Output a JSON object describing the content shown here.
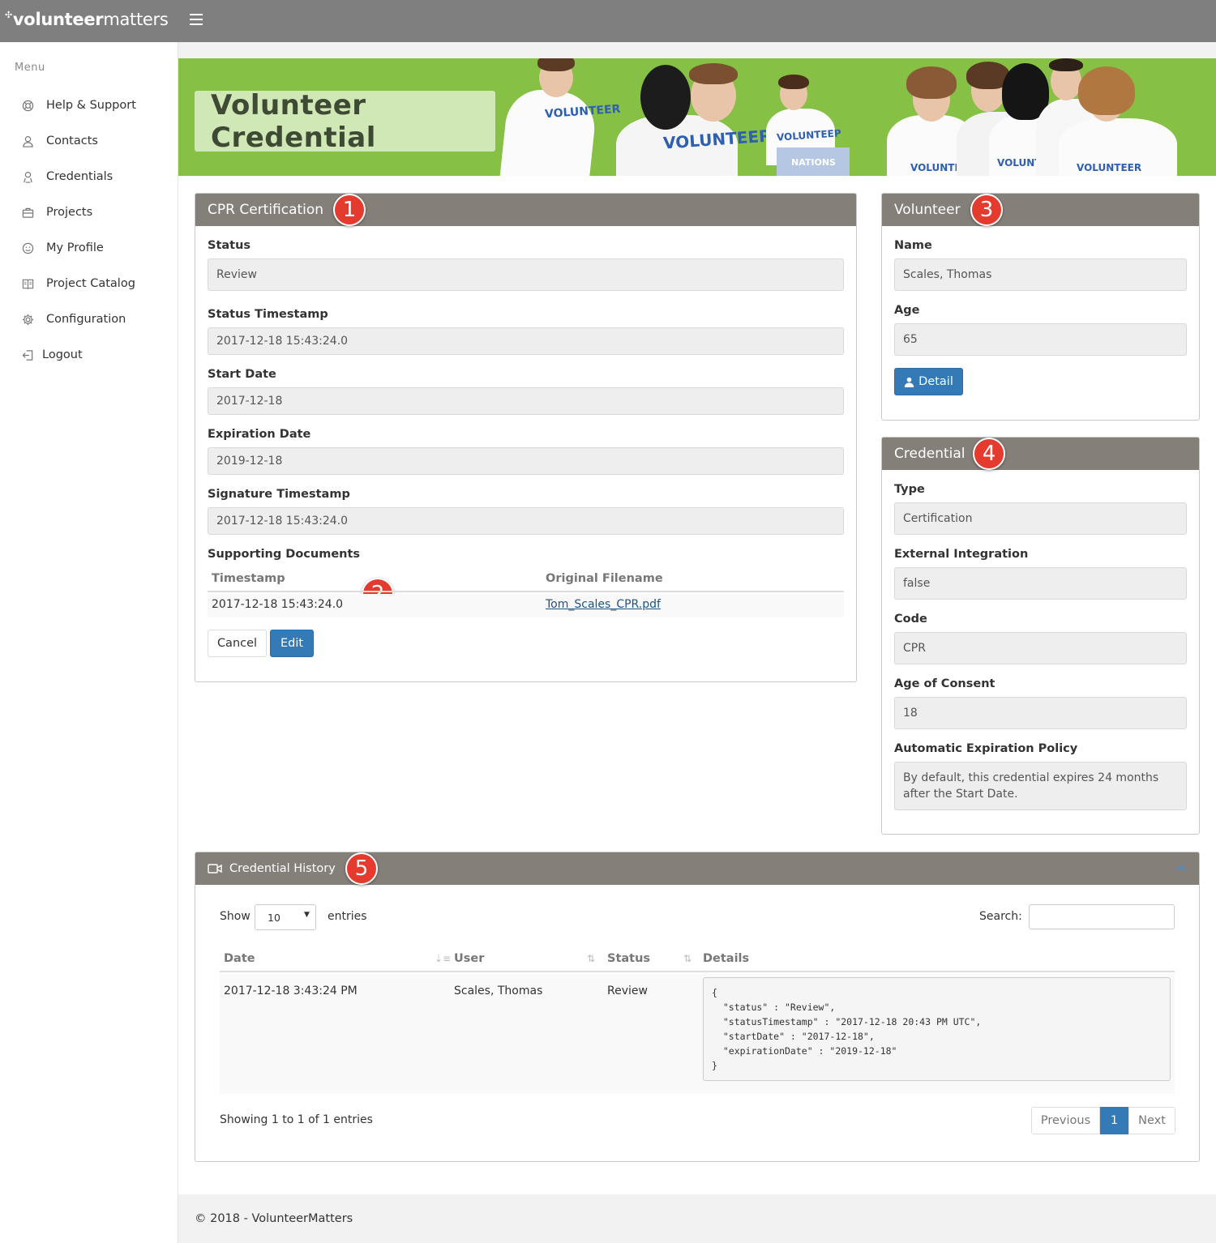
{
  "app": {
    "logo_bold": "volunteer",
    "logo_light": "matters"
  },
  "sidebar": {
    "title": "Menu",
    "items": [
      {
        "label": "Help & Support",
        "icon": "help-icon"
      },
      {
        "label": "Contacts",
        "icon": "contacts-icon"
      },
      {
        "label": "Credentials",
        "icon": "credentials-icon"
      },
      {
        "label": "Projects",
        "icon": "briefcase-icon"
      },
      {
        "label": "My Profile",
        "icon": "smiley-icon"
      },
      {
        "label": "Project Catalog",
        "icon": "catalog-icon"
      },
      {
        "label": "Configuration",
        "icon": "gear-icon"
      },
      {
        "label": "Logout",
        "icon": "logout-icon"
      }
    ]
  },
  "banner": {
    "title": "Volunteer Credential",
    "shirt_text": "VOLUNTEER",
    "shirt_text_alt": "VOLUNTEEP",
    "box_text": "NATIONS"
  },
  "cert_panel": {
    "title": "CPR Certification",
    "badge": "1",
    "fields": [
      {
        "label": "Status",
        "value": "Review"
      },
      {
        "label": "Status Timestamp",
        "value": "2017-12-18 15:43:24.0"
      },
      {
        "label": "Start Date",
        "value": "2017-12-18"
      },
      {
        "label": "Expiration Date",
        "value": "2019-12-18"
      },
      {
        "label": "Signature Timestamp",
        "value": "2017-12-18 15:43:24.0"
      }
    ],
    "docs": {
      "label": "Supporting Documents",
      "badge": "2",
      "col_timestamp": "Timestamp",
      "col_filename": "Original Filename",
      "rows": [
        {
          "timestamp": "2017-12-18 15:43:24.0",
          "filename": "Tom_Scales_CPR.pdf"
        }
      ]
    },
    "cancel_label": "Cancel",
    "edit_label": "Edit"
  },
  "volunteer_panel": {
    "title": "Volunteer",
    "badge": "3",
    "name_label": "Name",
    "name_value": "Scales, Thomas",
    "age_label": "Age",
    "age_value": "65",
    "detail_label": "Detail"
  },
  "credential_panel": {
    "title": "Credential",
    "badge": "4",
    "fields": [
      {
        "label": "Type",
        "value": "Certification"
      },
      {
        "label": "External Integration",
        "value": "false"
      },
      {
        "label": "Code",
        "value": "CPR"
      },
      {
        "label": "Age of Consent",
        "value": "18"
      }
    ],
    "policy_label": "Automatic Expiration Policy",
    "policy_value": "By default, this credential expires 24 months after the Start Date."
  },
  "history_panel": {
    "title": "Credential History",
    "badge": "5",
    "show_label": "Show",
    "entries_value": "10",
    "entries_label": "entries",
    "search_label": "Search:",
    "search_value": "",
    "columns": [
      "Date",
      "User",
      "Status",
      "Details"
    ],
    "rows": [
      {
        "date": "2017-12-18 3:43:24 PM",
        "user": "Scales, Thomas",
        "status": "Review",
        "details": "{\n  \"status\" : \"Review\",\n  \"statusTimestamp\" : \"2017-12-18 20:43 PM UTC\",\n  \"startDate\" : \"2017-12-18\",\n  \"expirationDate\" : \"2019-12-18\"\n}"
      }
    ],
    "info": "Showing 1 to 1 of 1 entries",
    "prev_label": "Previous",
    "page_label": "1",
    "next_label": "Next"
  },
  "footer": {
    "text": "© 2018 - VolunteerMatters"
  }
}
